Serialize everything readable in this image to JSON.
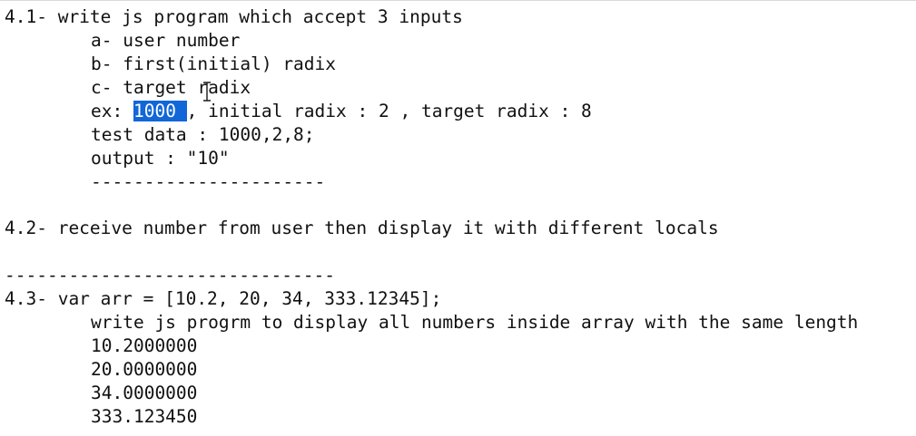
{
  "document": {
    "lines": [
      {
        "text": "4.1- write js program which accept 3 inputs"
      },
      {
        "text": "a- user number"
      },
      {
        "text": "b- first(initial) radix"
      },
      {
        "text": "c- target radix"
      },
      {
        "prefix": "ex: ",
        "selected": "1000 ",
        "suffix": ", initial radix : 2 , target radix : 8"
      },
      {
        "text": "test data : 1000,2,8;"
      },
      {
        "text": "output : \"10\""
      },
      {
        "text": "----------------------"
      },
      {
        "text": "4.2- receive number from user then display it with different locals"
      },
      {
        "text": "-------------------------------"
      },
      {
        "text": "4.3- var arr = [10.2, 20, 34, 333.12345];"
      },
      {
        "text": "write js progrm to display all numbers inside array with the same length"
      },
      {
        "text": "10.2000000"
      },
      {
        "text": "20.0000000"
      },
      {
        "text": "34.0000000"
      },
      {
        "text": "333.123450"
      }
    ]
  },
  "cursor": {
    "icon": "text-cursor-icon"
  }
}
